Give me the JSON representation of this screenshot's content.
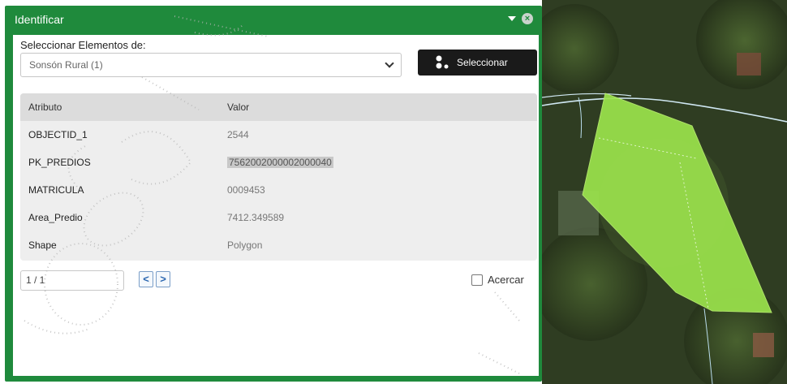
{
  "panel": {
    "title": "Identificar"
  },
  "selector": {
    "label": "Seleccionar Elementos de:",
    "selected_value": "Sonsón Rural (1)",
    "button_label": "Seleccionar"
  },
  "table": {
    "headers": {
      "attribute": "Atributo",
      "value": "Valor"
    },
    "rows": [
      {
        "attribute": "OBJECTID_1",
        "value": "2544"
      },
      {
        "attribute": "PK_PREDIOS",
        "value": "7562002000002000040"
      },
      {
        "attribute": "MATRICULA",
        "value": "0009453"
      },
      {
        "attribute": "Area_Predio",
        "value": "7412.349589"
      },
      {
        "attribute": "Shape",
        "value": "Polygon"
      }
    ]
  },
  "pager": {
    "value": "1 / 1",
    "prev": "<",
    "next": ">"
  },
  "zoom": {
    "label": "Acercar",
    "checked": false
  },
  "colors": {
    "panel_green": "#1f8a3c",
    "polygon_fill": "#9be34c",
    "button_dark": "#1a1a1a"
  }
}
